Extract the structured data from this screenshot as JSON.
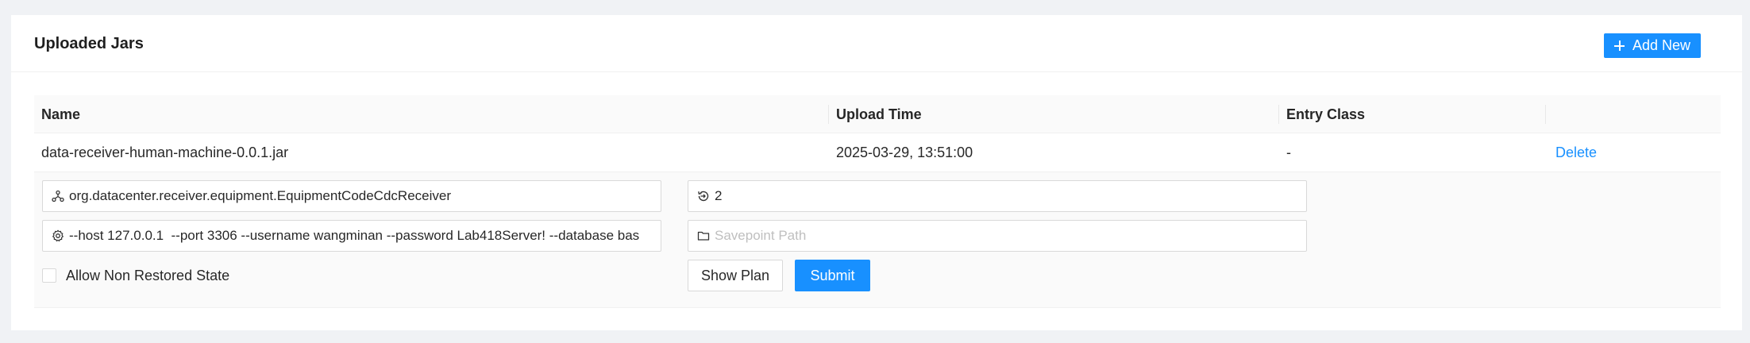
{
  "card": {
    "title": "Uploaded Jars",
    "add_button": "Add New"
  },
  "table": {
    "columns": [
      "Name",
      "Upload Time",
      "Entry Class",
      ""
    ],
    "rows": [
      {
        "name": "data-receiver-human-machine-0.0.1.jar",
        "upload_time": "2025-03-29, 13:51:00",
        "entry_class": "-",
        "action": "Delete"
      }
    ]
  },
  "run_form": {
    "entry_class_value": "org.datacenter.receiver.equipment.EquipmentCodeCdcReceiver",
    "parallelism_value": "2",
    "program_args_value": "--host 127.0.0.1  --port 3306 --username wangminan --password Lab418Server! --database bas",
    "savepoint_placeholder": "Savepoint Path",
    "allow_non_restored_label": "Allow Non Restored State",
    "show_plan_label": "Show Plan",
    "submit_label": "Submit"
  },
  "colors": {
    "primary": "#1890ff",
    "background": "#f0f2f5"
  },
  "icons": {
    "add": "plus-icon",
    "entry_class": "cluster-icon",
    "parallelism": "history-icon",
    "program_args": "gear-icon",
    "savepoint": "folder-icon"
  }
}
